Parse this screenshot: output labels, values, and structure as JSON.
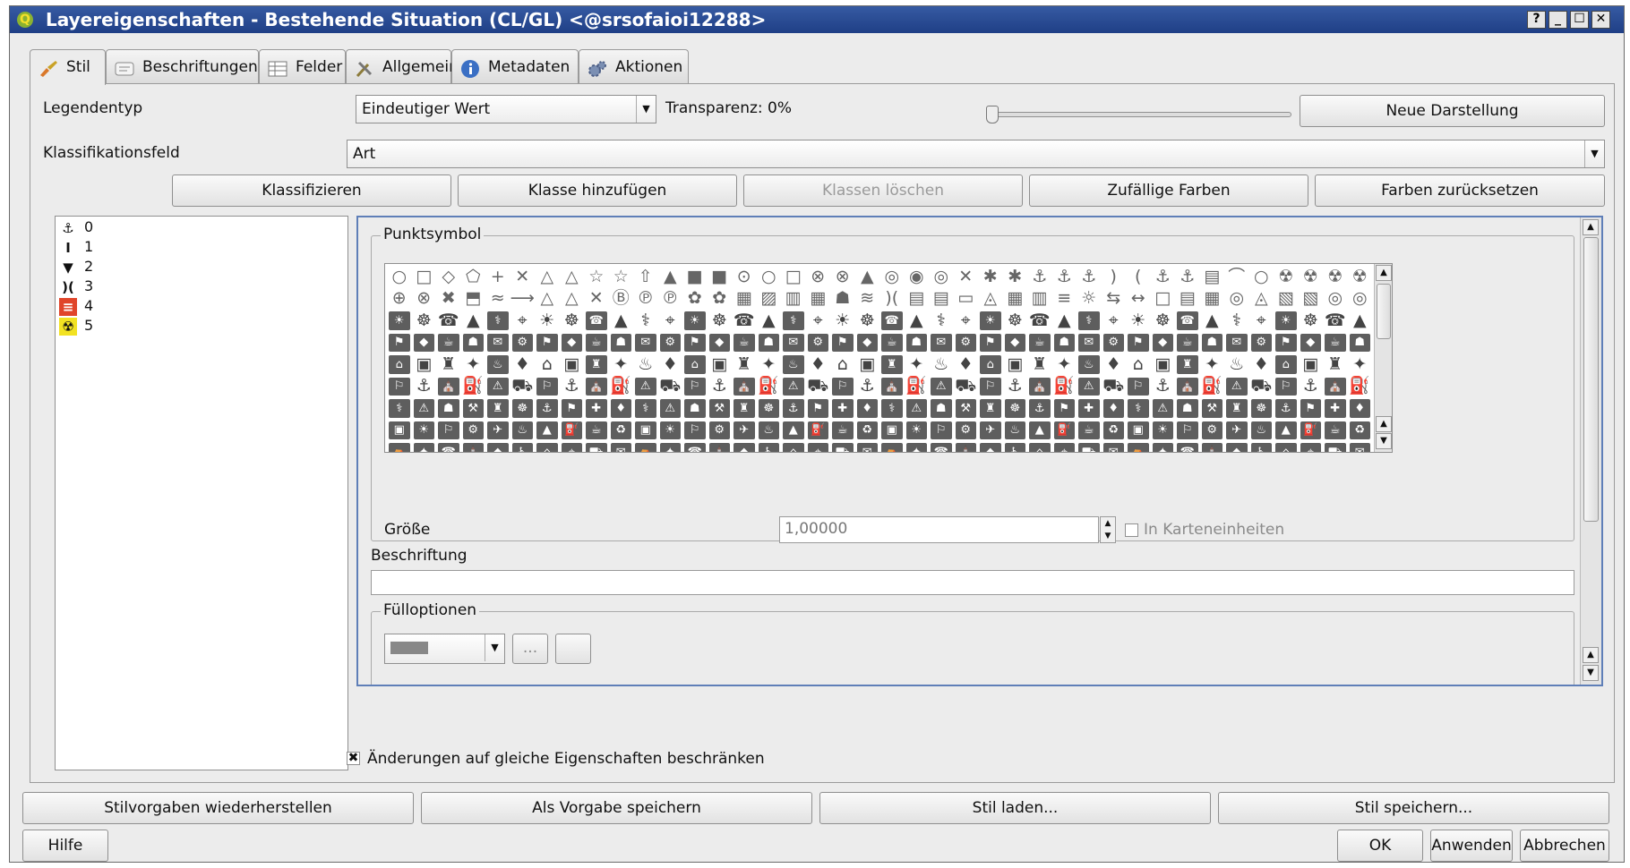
{
  "window": {
    "title": "Layereigenschaften - Bestehende Situation (CL/GL) <@srsofaioi12288>",
    "buttons": [
      "?",
      "_",
      "☐",
      "✕"
    ]
  },
  "tabs": [
    {
      "label": "Stil",
      "icon": "brush-icon"
    },
    {
      "label": "Beschriftungen",
      "icon": "label-icon"
    },
    {
      "label": "Felder",
      "icon": "table-icon"
    },
    {
      "label": "Allgemein",
      "icon": "tools-icon"
    },
    {
      "label": "Metadaten",
      "icon": "info-icon"
    },
    {
      "label": "Aktionen",
      "icon": "gears-icon"
    }
  ],
  "style": {
    "legend_type_label": "Legendentyp",
    "legend_type_value": "Eindeutiger Wert",
    "transparency_label": "Transparenz: 0%",
    "transparency_value": 0,
    "new_render_button": "Neue Darstellung",
    "classification_label": "Klassifikationsfeld",
    "classification_value": "Art",
    "buttons": {
      "classify": "Klassifizieren",
      "add_class": "Klasse hinzufügen",
      "delete_classes": "Klassen löschen",
      "random_colors": "Zufällige Farben",
      "reset_colors": "Farben zurücksetzen"
    },
    "classes": [
      {
        "value": "0",
        "icon": "anchor-icon"
      },
      {
        "value": "1",
        "icon": "tower-icon"
      },
      {
        "value": "2",
        "icon": "bucket-icon"
      },
      {
        "value": "3",
        "icon": "bridge-icon"
      },
      {
        "value": "4",
        "icon": "hazard-red-icon",
        "color": "#e0452a"
      },
      {
        "value": "5",
        "icon": "radiation-icon",
        "color": "#f2e222"
      }
    ],
    "point_symbol_title": "Punktsymbol",
    "size_label": "Größe",
    "size_value": "1,00000",
    "map_units_label": "In Karteneinheiten",
    "map_units_checked": false,
    "caption_label": "Beschriftung",
    "caption_value": "",
    "fill_options_title": "Fülloptionen",
    "fill_button": "...",
    "restrict_checkbox_label": "Änderungen auf gleiche Eigenschaften beschränken",
    "restrict_checked": true
  },
  "footer": {
    "restore_defaults": "Stilvorgaben wiederherstellen",
    "save_default": "Als Vorgabe speichern",
    "load_style": "Stil laden...",
    "save_style": "Stil speichern...",
    "help": "Hilfe",
    "ok": "OK",
    "apply": "Anwenden",
    "cancel": "Abbrechen"
  }
}
